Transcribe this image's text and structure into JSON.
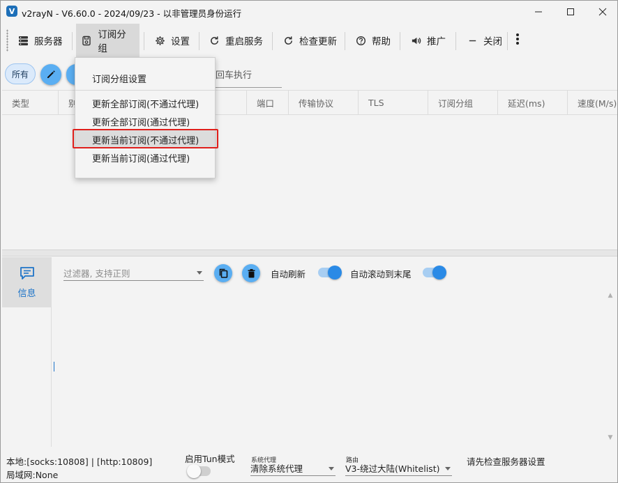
{
  "window": {
    "title": "v2rayN - V6.60.0 - 2024/09/23 - 以非管理员身份运行",
    "app_icon_letter": "V"
  },
  "toolbar": {
    "items": [
      {
        "label": "服务器",
        "icon": "server-icon"
      },
      {
        "label": "订阅分组",
        "icon": "subscription-icon"
      },
      {
        "label": "设置",
        "icon": "gear-icon"
      },
      {
        "label": "重启服务",
        "icon": "restart-icon"
      },
      {
        "label": "检查更新",
        "icon": "refresh-icon"
      },
      {
        "label": "帮助",
        "icon": "help-icon"
      },
      {
        "label": "推广",
        "icon": "speaker-icon"
      },
      {
        "label": "关闭",
        "icon": "minus-icon"
      }
    ],
    "more_icon": "more-vertical-icon"
  },
  "filter_bar": {
    "all_chip": "所有",
    "search_fragment": "回车执行"
  },
  "table": {
    "columns": [
      "类型",
      "别",
      "端口",
      "传输协议",
      "TLS",
      "订阅分组",
      "延迟(ms)",
      "速度(M/s)"
    ]
  },
  "subscription_menu": {
    "items": [
      "订阅分组设置",
      "更新全部订阅(不通过代理)",
      "更新全部订阅(通过代理)",
      "更新当前订阅(不通过代理)",
      "更新当前订阅(通过代理)"
    ],
    "highlight_color": "#e0201c"
  },
  "log_panel": {
    "tab_label": "信息",
    "filter_placeholder": "过滤器, 支持正则",
    "auto_refresh_label": "自动刷新",
    "auto_refresh": true,
    "auto_scroll_label": "自动滚动到末尾",
    "auto_scroll": true
  },
  "status_bar": {
    "local": "本地:[socks:10808] | [http:10809]",
    "lan": "局域网:None",
    "tun_label": "启用Tun模式",
    "tun_enabled": false,
    "system_proxy_label": "系统代理",
    "system_proxy_value": "清除系统代理",
    "routing_label": "路由",
    "routing_value": "V3-绕过大陆(Whitelist)",
    "message": "请先检查服务器设置"
  },
  "colors": {
    "accent": "#2a8ae6",
    "button_blue": "#5aaef2"
  }
}
